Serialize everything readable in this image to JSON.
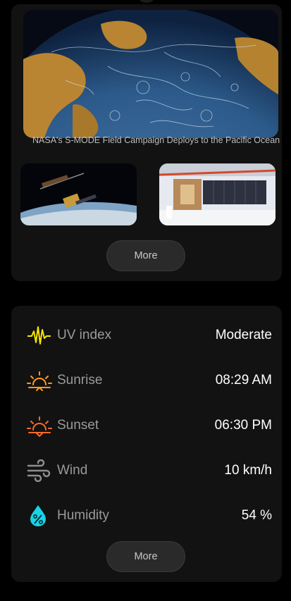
{
  "news": {
    "hero_caption": "NASA's S-MODE Field Campaign Deploys to the Pacific Ocean",
    "more_label": "More"
  },
  "weather": {
    "rows": [
      {
        "label": "UV index",
        "value": "Moderate",
        "icon": "uv-pulse-icon",
        "color": "#f5e600"
      },
      {
        "label": "Sunrise",
        "value": "08:29 AM",
        "icon": "sunrise-icon",
        "color": "#ff9a1f"
      },
      {
        "label": "Sunset",
        "value": "06:30 PM",
        "icon": "sunset-icon",
        "color": "#ff6a26"
      },
      {
        "label": "Wind",
        "value": "10 km/h",
        "icon": "wind-icon",
        "color": "#8e8e8e"
      },
      {
        "label": "Humidity",
        "value": "54 %",
        "icon": "humidity-drop-icon",
        "color": "#19d3e6"
      }
    ],
    "more_label": "More"
  }
}
